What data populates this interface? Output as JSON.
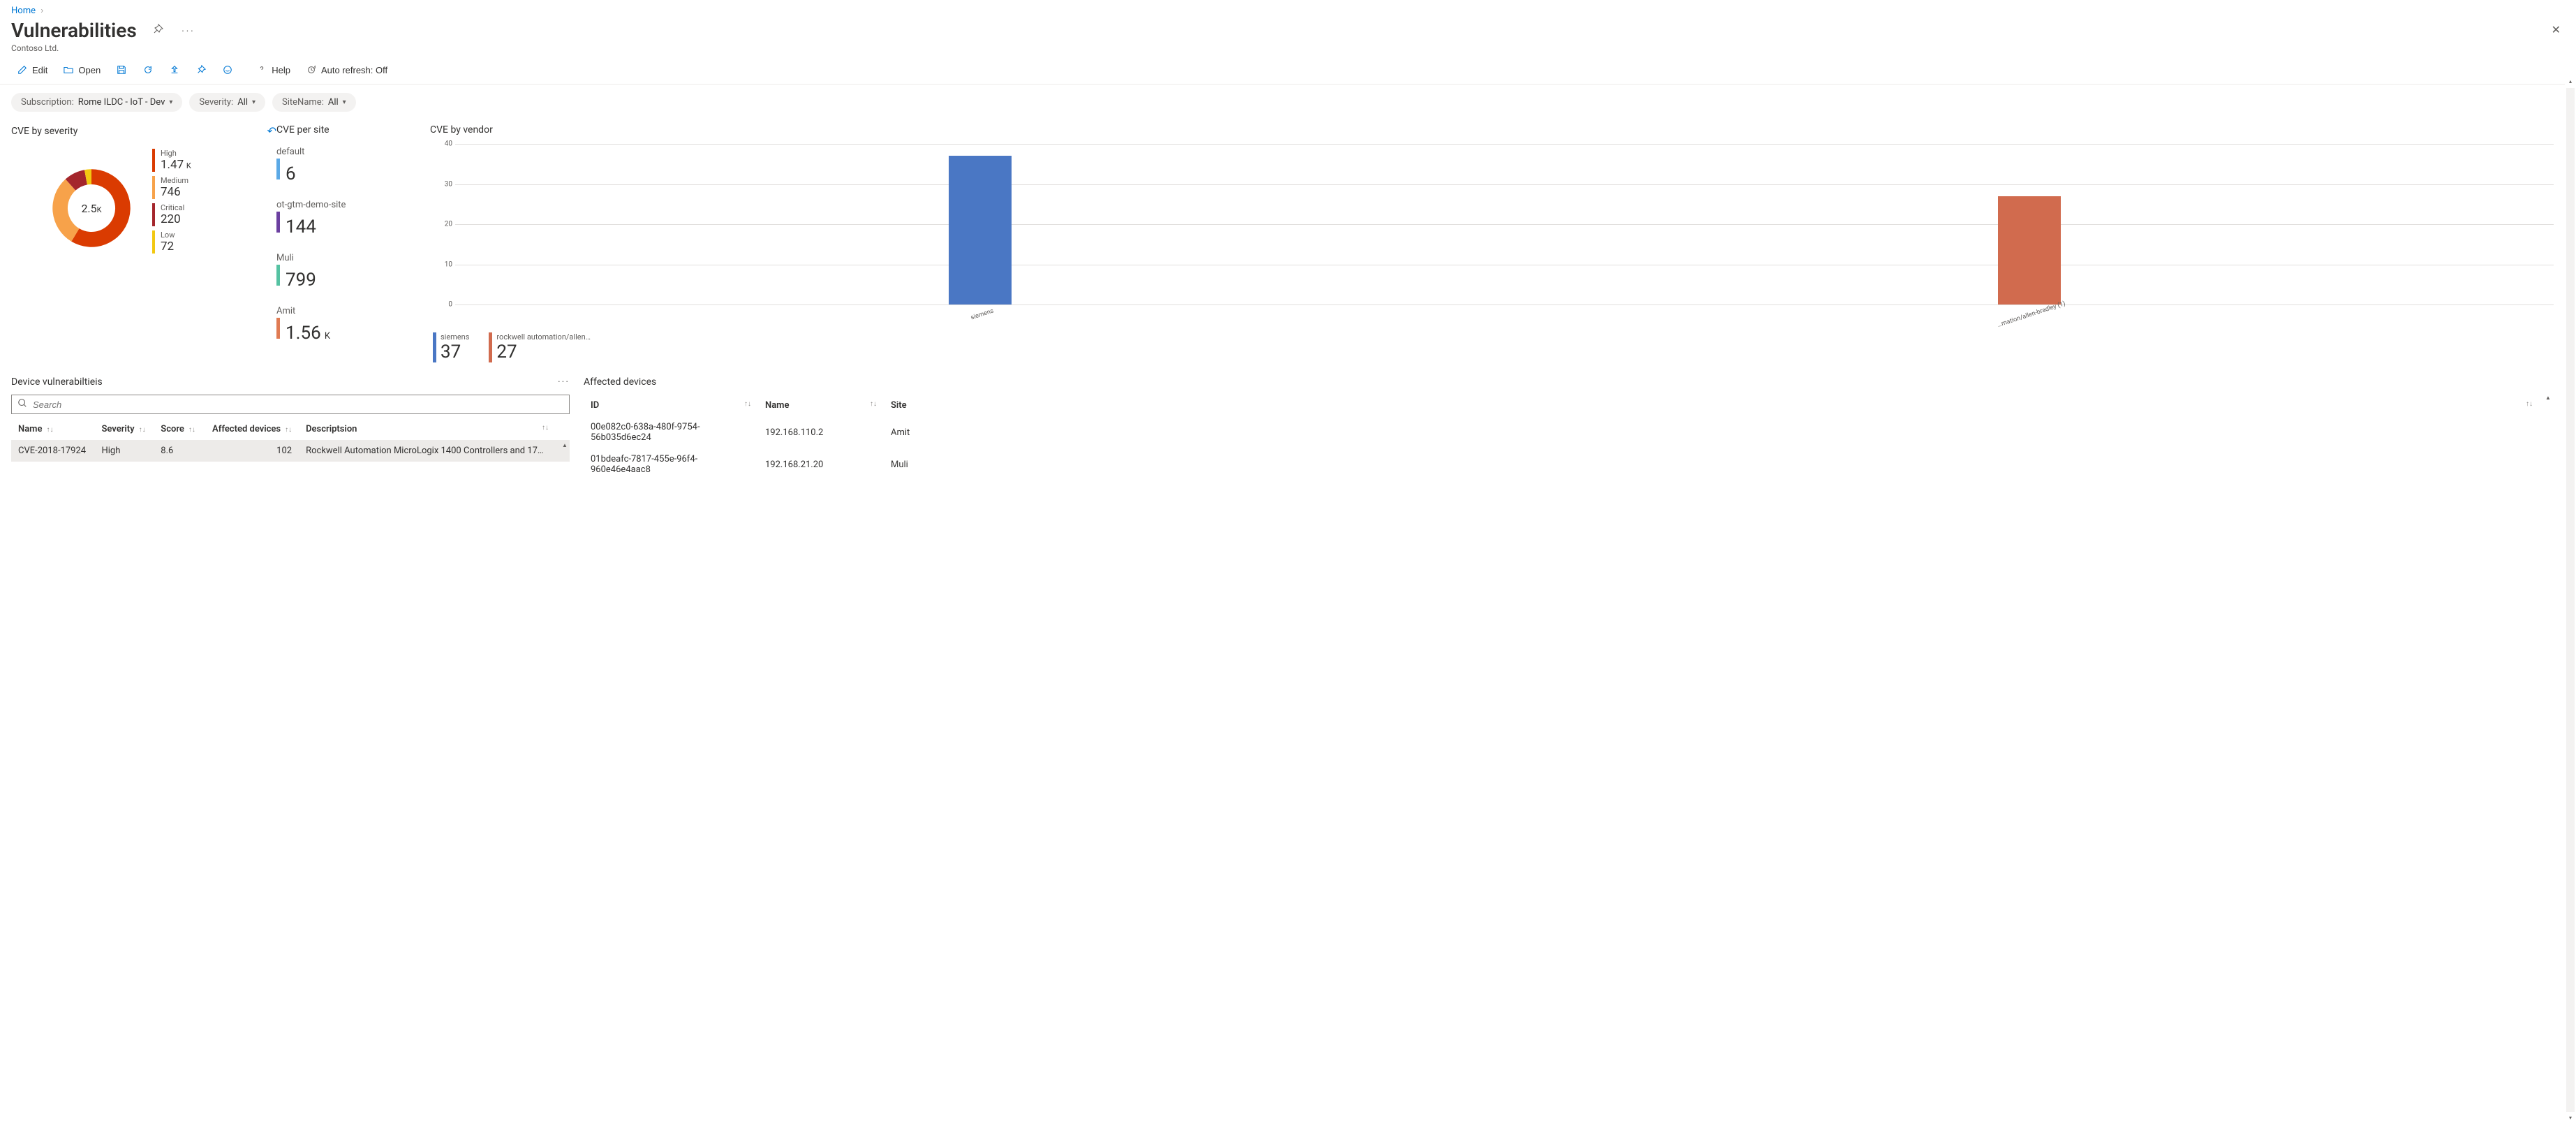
{
  "breadcrumb": {
    "home": "Home"
  },
  "header": {
    "title": "Vulnerabilities",
    "subtitle": "Contoso Ltd."
  },
  "toolbar": {
    "edit": "Edit",
    "open": "Open",
    "help": "Help",
    "autorefresh": "Auto refresh: Off"
  },
  "filters": {
    "sub_label": "Subscription:",
    "sub_value": "Rome ILDC - IoT - Dev",
    "sev_label": "Severity:",
    "sev_value": "All",
    "site_label": "SiteName:",
    "site_value": "All"
  },
  "panels": {
    "severity_title": "CVE by severity",
    "persite_title": "CVE per site",
    "vendor_title": "CVE by vendor"
  },
  "chart_data": {
    "severity_donut": {
      "type": "pie",
      "center": "2.5",
      "center_unit": "K",
      "series": [
        {
          "name": "High",
          "value": 1470,
          "display": "1.47",
          "unit": "K",
          "color": "#da3b01"
        },
        {
          "name": "Medium",
          "value": 746,
          "display": "746",
          "unit": "",
          "color": "#f7a24a"
        },
        {
          "name": "Critical",
          "value": 220,
          "display": "220",
          "unit": "",
          "color": "#a4262c"
        },
        {
          "name": "Low",
          "value": 72,
          "display": "72",
          "unit": "",
          "color": "#f2c811"
        }
      ]
    },
    "per_site": [
      {
        "name": "default",
        "value": 6,
        "display": "6",
        "unit": "",
        "color": "#5ba9e6"
      },
      {
        "name": "ot-gtm-demo-site",
        "value": 144,
        "display": "144",
        "unit": "",
        "color": "#6b3fa0"
      },
      {
        "name": "Muli",
        "value": 799,
        "display": "799",
        "unit": "",
        "color": "#55c2a2"
      },
      {
        "name": "Amit",
        "value": 1560,
        "display": "1.56",
        "unit": "K",
        "color": "#e07b53"
      }
    ],
    "vendor_bar": {
      "type": "bar",
      "ylim": [
        0,
        40
      ],
      "yticks": [
        0,
        10,
        20,
        30,
        40
      ],
      "categories": [
        "siemens",
        "…mation/allen-bradley (1)"
      ],
      "series": [
        {
          "name": "siemens",
          "short": "siemens",
          "value": 37,
          "color": "#4a77c4"
        },
        {
          "name": "rockwell automation/allen…",
          "short": "rockwell automation/allen…",
          "value": 27,
          "color": "#d16b4e"
        }
      ]
    }
  },
  "device_vuln": {
    "title": "Device vulnerabiltieis",
    "search_placeholder": "Search",
    "columns": {
      "name": "Name",
      "severity": "Severity",
      "score": "Score",
      "affected": "Affected devices",
      "desc": "Descriptsion"
    },
    "rows": [
      {
        "name": "CVE-2018-17924",
        "severity": "High",
        "score": "8.6",
        "affected": "102",
        "desc": "Rockwell Automation MicroLogix 1400 Controllers and 17…"
      }
    ]
  },
  "affected": {
    "title": "Affected devices",
    "columns": {
      "id": "ID",
      "name": "Name",
      "site": "Site"
    },
    "rows": [
      {
        "id": "00e082c0-638a-480f-9754-56b035d6ec24",
        "name": "192.168.110.2",
        "site": "Amit"
      },
      {
        "id": "01bdeafc-7817-455e-96f4-960e46e4aac8",
        "name": "192.168.21.20",
        "site": "Muli"
      }
    ]
  }
}
